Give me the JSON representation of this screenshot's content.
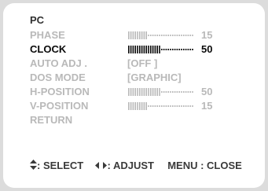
{
  "menu_title": "PC",
  "items": [
    {
      "label": "PHASE",
      "type": "slider",
      "value": "15",
      "level": 0.3,
      "active": false
    },
    {
      "label": "CLOCK",
      "type": "slider",
      "value": "50",
      "level": 0.5,
      "active": true
    },
    {
      "label": "AUTO ADJ .",
      "type": "option",
      "value": "OFF",
      "active": false
    },
    {
      "label": "DOS MODE",
      "type": "option",
      "value": "GRAPHIC",
      "active": false
    },
    {
      "label": "H-POSITION",
      "type": "slider",
      "value": "50",
      "level": 0.5,
      "active": false
    },
    {
      "label": "V-POSITION",
      "type": "slider",
      "value": "15",
      "level": 0.3,
      "active": false
    },
    {
      "label": "RETURN",
      "type": "action",
      "active": false
    }
  ],
  "footer": {
    "select_label": ": SELECT",
    "adjust_label": ": ADJUST",
    "menu_close_label": "MENU : CLOSE"
  },
  "colors": {
    "background": "#dcdcdc",
    "panel": "#ffffff",
    "active_text": "#0a0a0a",
    "inactive_text": "#b9b9b9"
  }
}
